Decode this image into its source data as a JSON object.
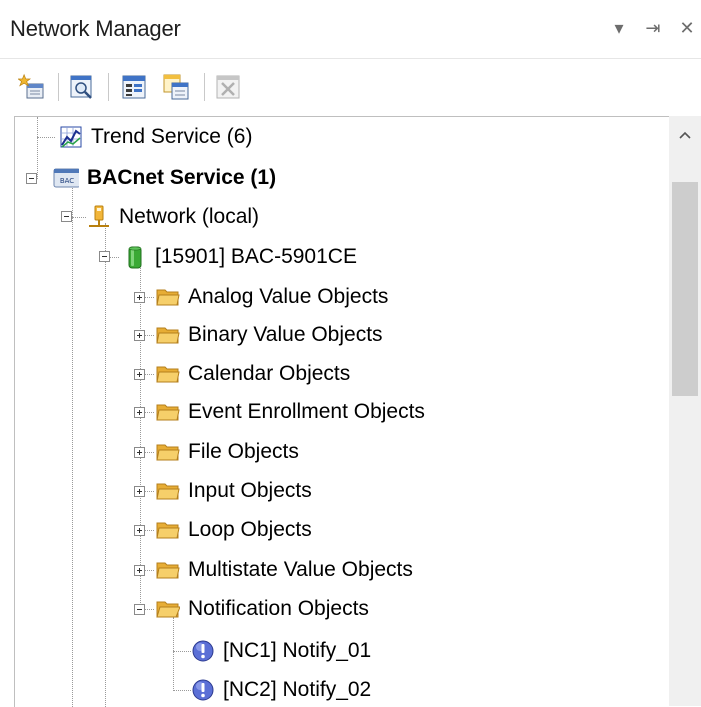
{
  "window": {
    "title": "Network Manager",
    "actions": {
      "dropdown": "▾",
      "pin": "⇥",
      "close": "✕"
    }
  },
  "toolbar": {
    "buttons": [
      {
        "name": "add-icon"
      },
      {
        "name": "search-icon"
      },
      {
        "name": "properties-icon"
      },
      {
        "name": "copy-icon"
      },
      {
        "name": "delete-icon"
      }
    ]
  },
  "tree": {
    "trend_service": "Trend Service (6)",
    "bacnet_service": "BACnet Service (1)",
    "network": "Network (local)",
    "device": "[15901] BAC-5901CE",
    "folders": [
      "Analog Value Objects",
      "Binary Value Objects",
      "Calendar Objects",
      "Event Enrollment Objects",
      "File Objects",
      "Input Objects",
      "Loop Objects",
      "Multistate Value Objects",
      "Notification Objects"
    ],
    "notifications": [
      "[NC1] Notify_01",
      "[NC2] Notify_02"
    ],
    "bac_icon_text": "BAC"
  },
  "colors": {
    "folder": "#f1c24f",
    "folder_dark": "#c99225",
    "device_green": "#3aa935",
    "notify_blue": "#5b6fd6",
    "scroll_thumb": "#cdcdcd"
  }
}
